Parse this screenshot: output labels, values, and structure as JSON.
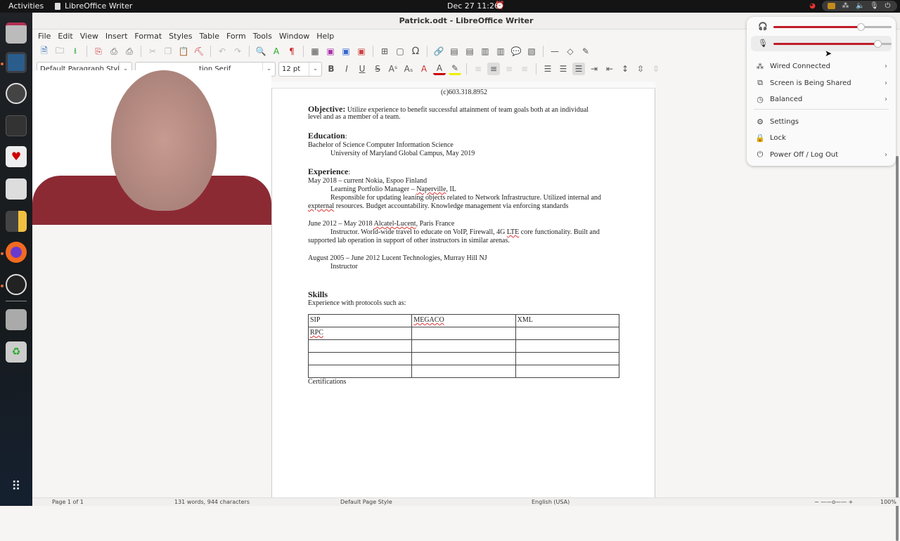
{
  "topbar": {
    "activities": "Activities",
    "app_name": "LibreOffice Writer",
    "clock": "Dec 27  11:26"
  },
  "window": {
    "title": "Patrick.odt - LibreOffice Writer",
    "menu": [
      "File",
      "Edit",
      "View",
      "Insert",
      "Format",
      "Styles",
      "Table",
      "Form",
      "Tools",
      "Window",
      "Help"
    ]
  },
  "formatting": {
    "paragraph_style": "Default Paragraph Styl",
    "font_name": "Liberation Serif",
    "font_name_visible": "tion Serif",
    "font_size": "12 pt"
  },
  "document": {
    "phone": "(c)603.318.8952",
    "objective_heading": "Objective:",
    "objective_text_1": " Utilize experience to benefit successful attainment of team goals both at an individual",
    "objective_text_2": "level and as a member of a team.",
    "education_heading": "Education",
    "education_line1": "Bachelor of Science Computer Information Science",
    "education_line2": "University of Maryland Global Campus, May 2019",
    "experience_heading": "Experience",
    "exp1_line1": "May 2018 – current  Nokia, Espoo Finland",
    "exp1_role_a": "Learning Portfolio Manager – ",
    "exp1_role_b": "Naperville",
    "exp1_role_c": ", IL",
    "exp1_desc1": "Responsible for updating leaning objects related to Network Infrastructure. Utilized internal and",
    "exp1_desc2a": "expternal",
    "exp1_desc2b": " resources. Budget accountability. Knowledge management via enforcing standards",
    "exp2_line1a": "June 2012 – May 2018 ",
    "exp2_line1b": "Alcatel-Lucent",
    "exp2_line1c": ", Paris France",
    "exp2_desc1a": "Instructor.  World-wide travel to educate on VoIP, Firewall, 4G ",
    "exp2_desc1b": "LTE",
    "exp2_desc1c": " core functionality. Built and",
    "exp2_desc2": "supported lab operation in support of other instructors in similar arenas.",
    "exp3_line1": "August 2005 – June 2012 Lucent Technologies, Murray Hill NJ",
    "exp3_role": "Instructor",
    "skills_heading": "Skills",
    "skills_intro": "Experience with protocols such as:",
    "skills_table": [
      [
        "SIP",
        "MEGACO",
        "XML"
      ],
      [
        "RPC",
        "",
        ""
      ],
      [
        "",
        "",
        ""
      ],
      [
        "",
        "",
        ""
      ],
      [
        "",
        "",
        ""
      ]
    ],
    "certifications": "Certifications"
  },
  "statusbar": {
    "page": "Page 1 of 1",
    "words": "131 words, 944 characters",
    "page_style": "Default Page Style",
    "language": "English (USA)",
    "zoom": "100%"
  },
  "quick_settings": {
    "output_volume": 0.74,
    "input_volume": 0.88,
    "items": [
      {
        "label": "Wired Connected",
        "icon": "network-icon",
        "submenu": true
      },
      {
        "label": "Screen is Being Shared",
        "icon": "screen-share-icon",
        "submenu": true
      },
      {
        "label": "Balanced",
        "icon": "power-profile-icon",
        "submenu": true
      },
      {
        "label": "Settings",
        "icon": "gear-icon",
        "submenu": false
      },
      {
        "label": "Lock",
        "icon": "lock-icon",
        "submenu": false
      },
      {
        "label": "Power Off / Log Out",
        "icon": "power-icon",
        "submenu": true
      }
    ]
  },
  "colors": {
    "accent": "#c01c28",
    "dock_dot": "#e06a3a"
  }
}
